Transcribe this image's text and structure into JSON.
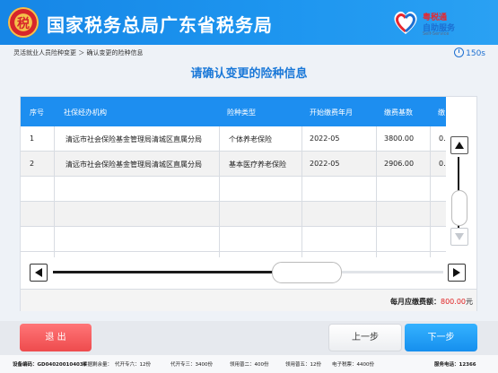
{
  "header": {
    "title": "国家税务总局广东省税务局",
    "emblem_char": "税",
    "logo_line1": "粤税通",
    "logo_line2": "自助服务",
    "logo_line3": "Self-Service"
  },
  "breadcrumb": "灵活就业人员险种变更 ＞ 确认变更的险种信息",
  "timer": "150s",
  "page_title": "请确认变更的险种信息",
  "table": {
    "headers": [
      "序号",
      "社保经办机构",
      "险种类型",
      "开始缴费年月",
      "缴费基数",
      "缴"
    ],
    "rows": [
      [
        "1",
        "清远市社会保险基金管理局清城区直属分局",
        "个体养老保险",
        "2022-05",
        "3800.00",
        "0.("
      ],
      [
        "2",
        "清远市社会保险基金管理局清城区直属分局",
        "基本医疗养老保险",
        "2022-05",
        "2906.00",
        "0."
      ]
    ]
  },
  "total": {
    "label": "每月应缴费额：",
    "amount": "800.00",
    "unit": "元"
  },
  "buttons": {
    "exit": "退 出",
    "prev": "上一步",
    "next": "下一步"
  },
  "status_bar": {
    "device": "设备编码：GD040200104036",
    "stock_label": "票据剩余量：",
    "items": [
      "代开专六：12份",
      "代开专三：3400份",
      "领用普二：400份",
      "领用普五：12份",
      "电子税票：4400份"
    ],
    "hotline": "服务电话：12366"
  },
  "colors": {
    "header": "#1d8ef0",
    "title": "#1a78d8",
    "exit": "#ee4b4d",
    "next": "#168fee",
    "amount": "#e02020"
  }
}
